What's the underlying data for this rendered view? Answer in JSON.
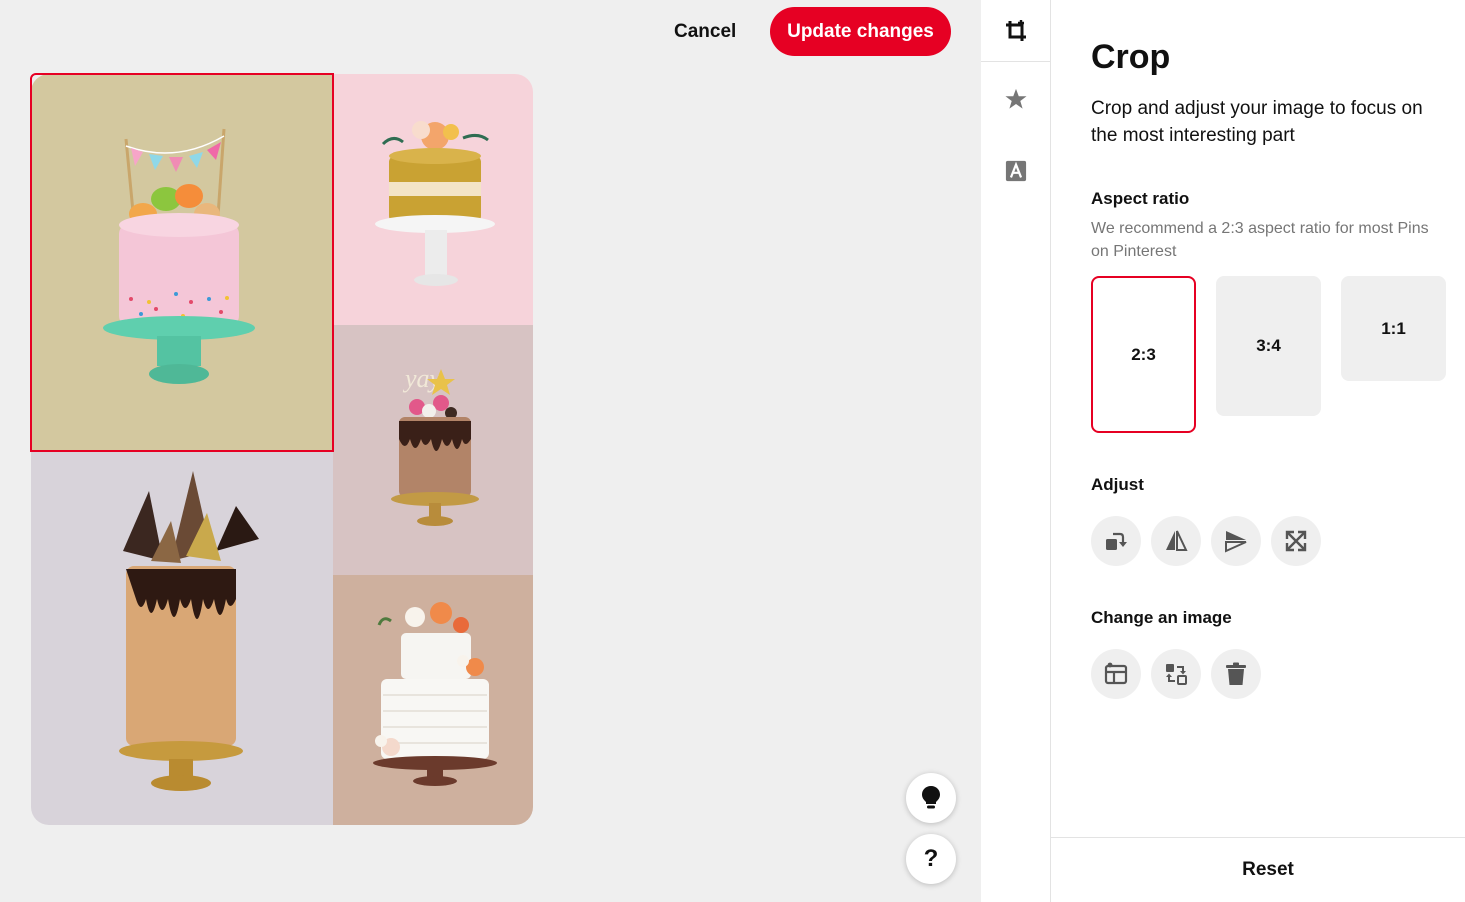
{
  "header": {
    "cancel_label": "Cancel",
    "update_label": "Update changes"
  },
  "colors": {
    "accent": "#e60023",
    "canvas_bg": "#efefef",
    "button_gray": "#efefef",
    "hint_text": "#767676"
  },
  "collage": {
    "tiles": [
      {
        "name": "pink-sprinkle-cake-with-macarons",
        "selected": true
      },
      {
        "name": "gold-naked-cake-with-flowers",
        "selected": false
      },
      {
        "name": "chocolate-drip-cake-small",
        "selected": false
      },
      {
        "name": "chocolate-drip-cake-with-shards",
        "selected": false
      },
      {
        "name": "white-tiered-cake-with-flowers",
        "selected": false
      }
    ]
  },
  "rail": {
    "items": [
      {
        "icon": "crop-icon",
        "active": true
      },
      {
        "icon": "star-icon",
        "active": false
      },
      {
        "icon": "text-icon",
        "active": false
      }
    ]
  },
  "panel": {
    "title": "Crop",
    "description": "Crop and adjust your image to focus on the most interesting part",
    "aspect": {
      "heading": "Aspect ratio",
      "hint": "We recommend a 2:3 aspect ratio for most Pins on Pinterest",
      "options": [
        "2:3",
        "3:4",
        "1:1"
      ],
      "selected": "2:3"
    },
    "adjust": {
      "heading": "Adjust",
      "icons": [
        "rotate-icon",
        "flip-horizontal-icon",
        "flip-vertical-icon",
        "expand-icon"
      ]
    },
    "change": {
      "heading": "Change an image",
      "icons": [
        "replace-image-icon",
        "swap-image-icon",
        "trash-icon"
      ]
    },
    "reset_label": "Reset"
  },
  "floating": {
    "tips_icon": "lightbulb-icon",
    "help_label": "?"
  }
}
